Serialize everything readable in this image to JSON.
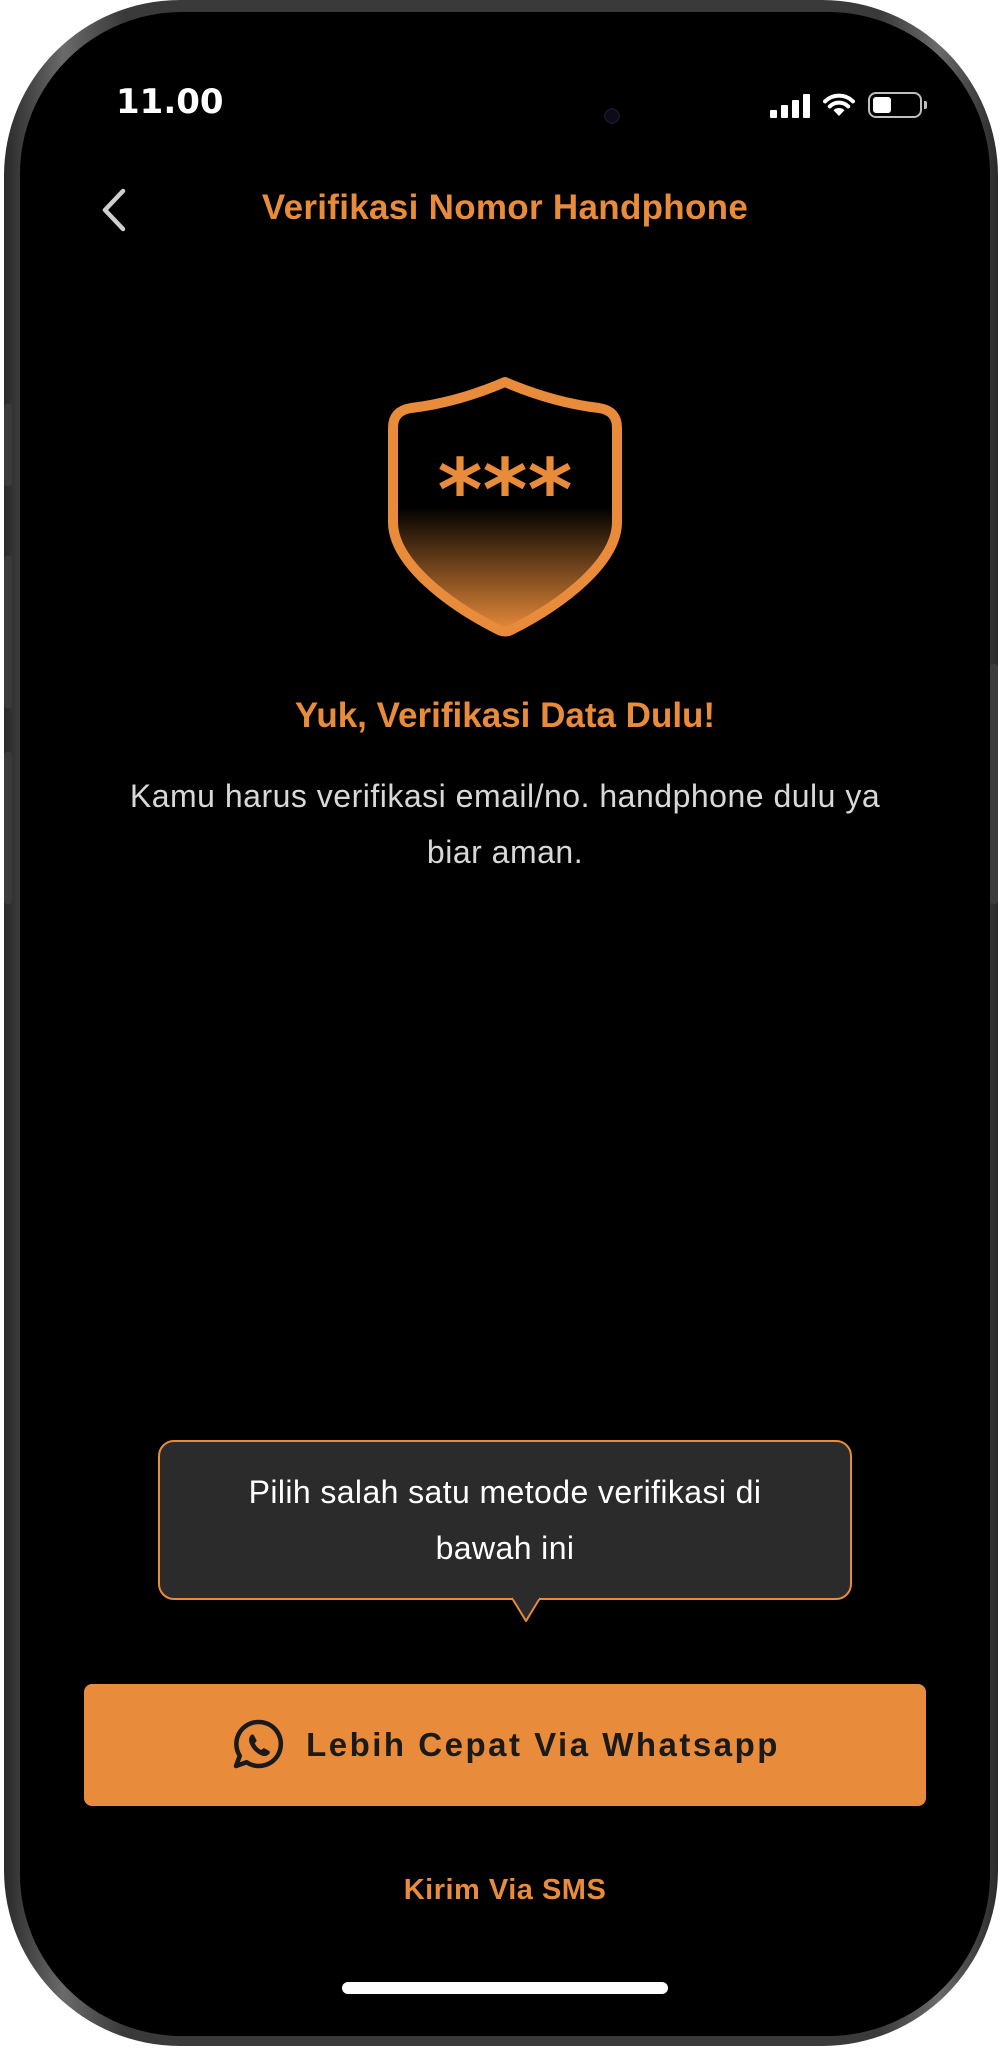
{
  "status_bar": {
    "time": "11.00"
  },
  "header": {
    "title": "Verifikasi Nomor Handphone",
    "back_icon": "chevron-left-icon"
  },
  "hero": {
    "icon": "shield-password-icon",
    "icon_text": "***",
    "headline": "Yuk, Verifikasi Data Dulu!",
    "description": "Kamu harus verifikasi email/no. handphone dulu ya biar aman."
  },
  "tooltip": {
    "text": "Pilih salah satu metode verifikasi di bawah ini"
  },
  "actions": {
    "whatsapp_label": "Lebih Cepat Via Whatsapp",
    "whatsapp_icon": "whatsapp-icon",
    "sms_label": "Kirim Via SMS"
  },
  "colors": {
    "accent": "#e88b3a",
    "background": "#000000",
    "tooltip_bg": "#2b2b2b"
  }
}
